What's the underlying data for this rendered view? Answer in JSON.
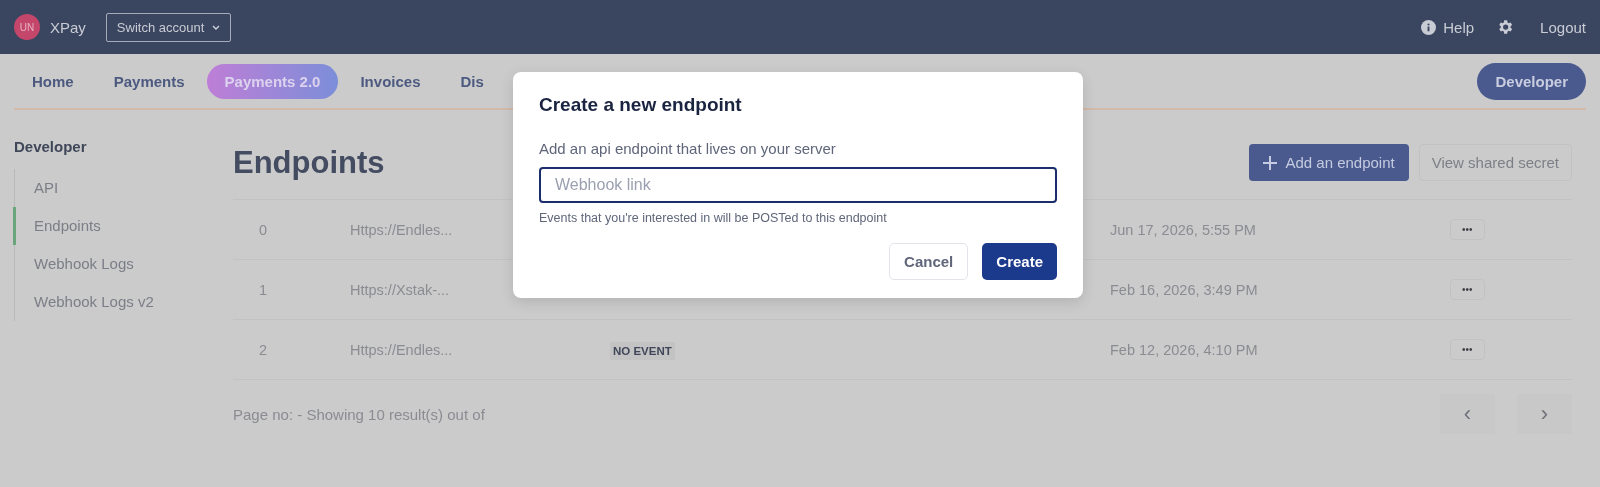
{
  "topbar": {
    "avatar": "UN",
    "brand": "XPay",
    "account_switch": "Switch account",
    "help": "Help",
    "logout": "Logout"
  },
  "nav": {
    "tabs": [
      {
        "label": "Home",
        "selected": false
      },
      {
        "label": "Payments",
        "selected": false
      },
      {
        "label": "Payments 2.0",
        "selected": true
      },
      {
        "label": "Invoices",
        "selected": false
      },
      {
        "label": "Dis",
        "selected": false
      }
    ],
    "developer_button": "Developer"
  },
  "sidebar": {
    "title": "Developer",
    "items": [
      {
        "label": "API",
        "selected": false
      },
      {
        "label": "Endpoints",
        "selected": true
      },
      {
        "label": "Webhook Logs",
        "selected": false
      },
      {
        "label": "Webhook Logs v2",
        "selected": false
      }
    ]
  },
  "page": {
    "title": "Endpoints",
    "add_button": "Add an endpoint",
    "secret_button": "View shared secret"
  },
  "table": {
    "rows": [
      {
        "index": "0",
        "url": "Https://Endles...",
        "date": "Jun 17, 2026, 5:55 PM",
        "menu": "•••"
      },
      {
        "index": "1",
        "url": "Https://Xstak-...",
        "date": "Feb 16, 2026, 3:49 PM",
        "menu": "•••"
      },
      {
        "index": "2",
        "url": "Https://Endles...",
        "event": "NO EVENT",
        "date": "Feb 12, 2026, 4:10 PM",
        "menu": "•••"
      }
    ]
  },
  "pagination": {
    "summary": "Page no: - Showing 10 result(s) out of",
    "prev": "‹",
    "next": "›"
  },
  "dialog": {
    "title": "Create a new endpoint",
    "label": "Add an api endpoint that lives on your server",
    "placeholder": "Webhook link",
    "hint": "Events that you're interested in will be POSTed to this endpoint",
    "cancel": "Cancel",
    "create": "Create"
  }
}
